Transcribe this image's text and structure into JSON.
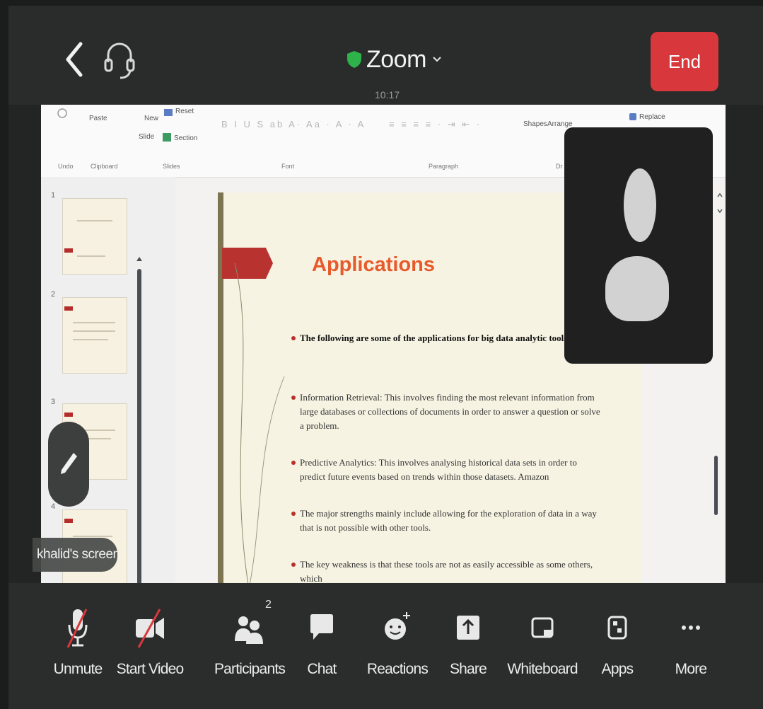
{
  "header": {
    "app_title": "Zoom",
    "time": "10:17",
    "end_label": "End",
    "colors": {
      "end": "#d8383c",
      "shield": "#2db34a"
    }
  },
  "ribbon": {
    "paste": "Paste",
    "new_slide": "New",
    "slide_label": "Slide",
    "reset": "Reset",
    "section": "Section",
    "shapes": "Shapes",
    "arrange": "Arrange",
    "replace": "Replace",
    "groups": {
      "undo": "Undo",
      "clipboard": "Clipboard",
      "slides": "Slides",
      "font": "Font",
      "paragraph": "Paragraph",
      "drawing": "Dr"
    }
  },
  "thumbnails": [
    {
      "number": "1"
    },
    {
      "number": "2"
    },
    {
      "number": "3"
    },
    {
      "number": "4"
    }
  ],
  "slide": {
    "title": "Applications",
    "bullets": [
      "The following are some of the applications for big data analytic tools",
      "Information Retrieval:  This involves finding the most relevant information from large databases or collections of documents in order to answer a question or solve a problem.",
      "Predictive Analytics: This involves analysing historical data sets in order to predict future events based on trends within those datasets. Amazon",
      "The major strengths mainly include allowing for the exploration of data in a way that is not possible with other tools.",
      "The key weakness is that these tools are not as easily accessible as some others, which"
    ]
  },
  "screen_label": "khalid's screen",
  "participants_count": "2",
  "toolbar": {
    "unmute": "Unmute",
    "start_video": "Start Video",
    "participants": "Participants",
    "chat": "Chat",
    "reactions": "Reactions",
    "share": "Share",
    "whiteboard": "Whiteboard",
    "apps": "Apps",
    "more": "More"
  }
}
